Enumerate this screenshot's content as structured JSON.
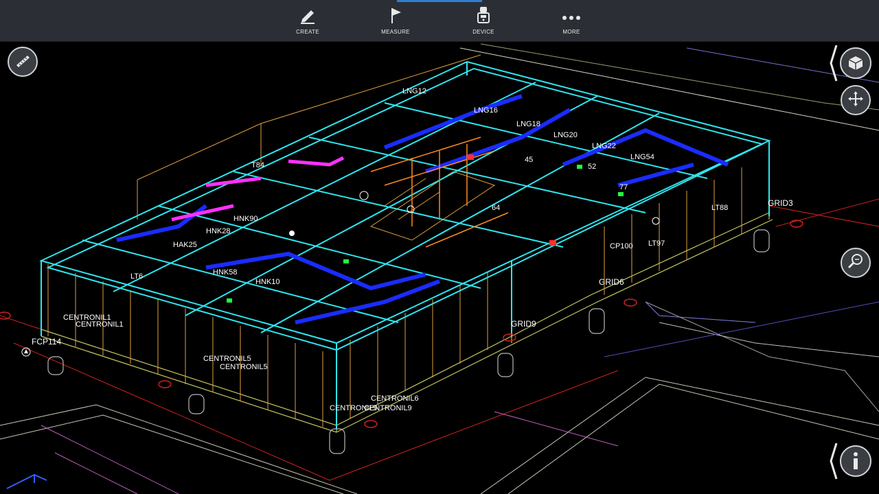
{
  "toolbar": {
    "items": [
      {
        "label": "CREATE",
        "icon": "pencil-icon"
      },
      {
        "label": "MEASURE",
        "icon": "flag-icon"
      },
      {
        "label": "DEVICE",
        "icon": "device-icon"
      },
      {
        "label": "MORE",
        "icon": "more-dots-icon"
      }
    ]
  },
  "right_controls": {
    "view_cube": "cube-icon",
    "pan": "move-arrows-icon",
    "zoom": "zoom-icon",
    "info": "info-icon"
  },
  "left_controls": {
    "markup": "ruler-pencil-icon"
  },
  "model_labels": {
    "grid3": "GRID3",
    "grid6": "GRID6",
    "grid9": "GRID9",
    "fcp114": "FCP114",
    "centronil1": "CENTRONIL1",
    "centronil5": "CENTRONIL5",
    "centronil6": "CENTRONIL6",
    "centronil9": "CENTRONIL9",
    "lng12": "LNG12",
    "lng16": "LNG16",
    "lng18": "LNG18",
    "lng20": "LNG20",
    "lng22": "LNG22",
    "lng54": "LNG54",
    "hnk25": "HAK25",
    "hnk58": "HNK58",
    "hnk10": "HNK10",
    "hnk90": "HNK90",
    "hnk28": "HNK28",
    "lt6": "LT6",
    "lt88": "LT88",
    "lt97": "LT97",
    "cp100": "CP100",
    "t84": "T84",
    "h64": "64",
    "h45": "45",
    "h52": "52",
    "h77": "77"
  },
  "colors": {
    "toolbar_bg": "#2b2f35",
    "accent": "#2e7fd0",
    "frame_cyan": "#2ee6f0",
    "frame_orange": "#e0a040",
    "duct_blue": "#1a2cff",
    "duct_magenta": "#ff30ff",
    "grid_red": "#d02020",
    "site_line": "#c8c8b8"
  }
}
